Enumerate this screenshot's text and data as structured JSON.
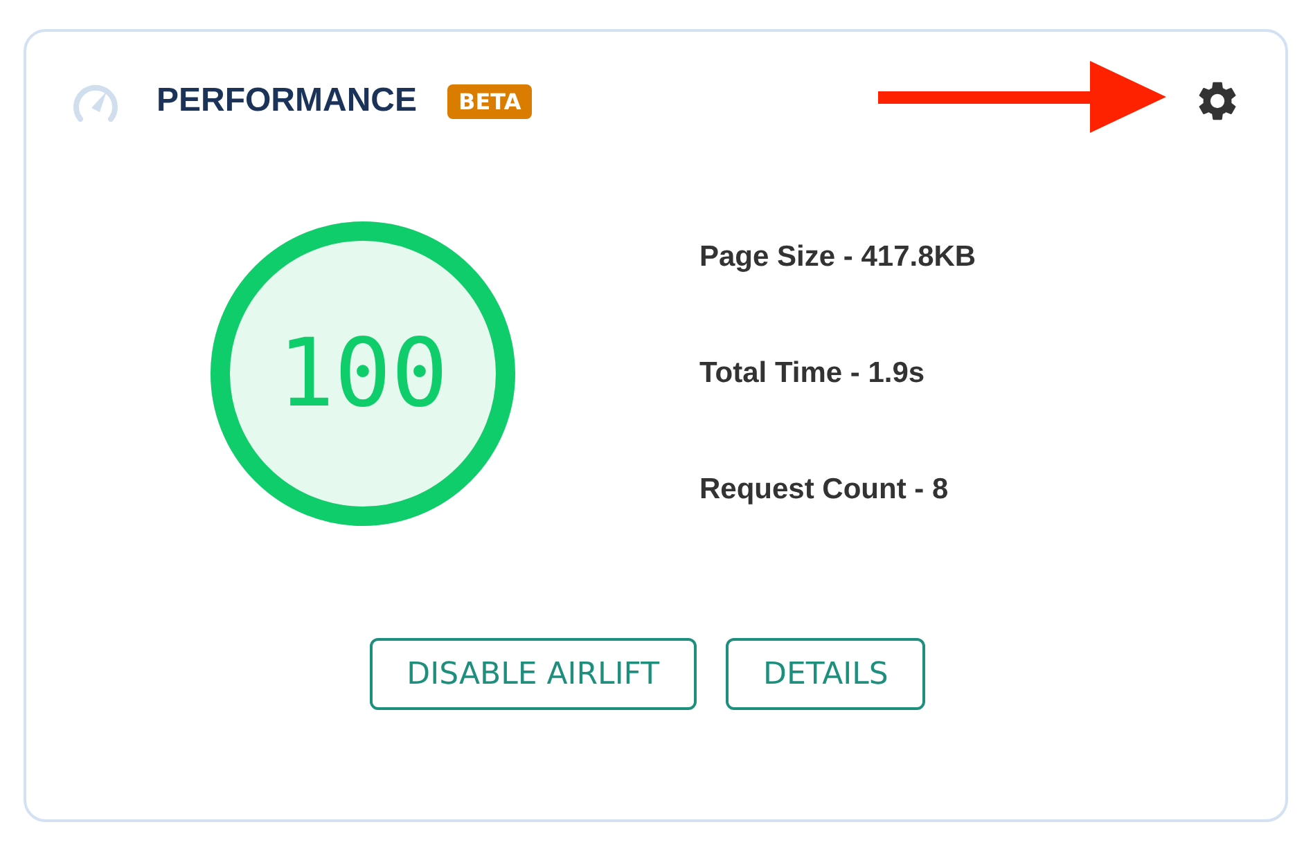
{
  "card": {
    "title": "PERFORMANCE",
    "badge": "BETA"
  },
  "score": {
    "value": "100",
    "level": 1
  },
  "stats": [
    "Page Size - 417.8KB",
    "Total Time - 1.9s",
    "Request Count - 8"
  ],
  "buttons": [
    "DISABLE AIRLIFT",
    "DETAILS"
  ]
}
